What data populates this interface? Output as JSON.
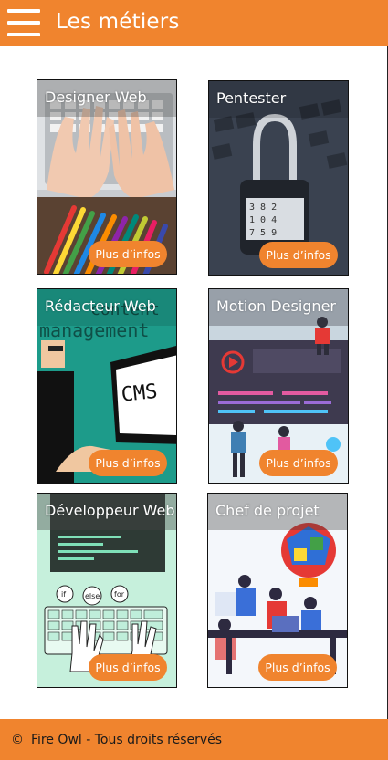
{
  "header": {
    "title": "Les métiers",
    "menu_icon": "hamburger-menu-icon"
  },
  "cards": [
    {
      "title": "Designer Web",
      "button": "Plus d’infos"
    },
    {
      "title": "Pentester",
      "button": "Plus d’infos"
    },
    {
      "title": "Rédacteur Web",
      "button": "Plus d’infos",
      "image_text_1": "content",
      "image_text_2": "management",
      "image_text_3": "CMS"
    },
    {
      "title": "Motion Designer",
      "button": "Plus d’infos"
    },
    {
      "title": "Développeur Web",
      "button": "Plus d’infos",
      "image_text_1": "if",
      "image_text_2": "else",
      "image_text_3": "for"
    },
    {
      "title": "Chef de projet",
      "button": "Plus d’infos"
    }
  ],
  "footer": {
    "copyright_symbol": "©",
    "text": "Fire Owl - Tous droits réservés"
  },
  "colors": {
    "accent": "#f0842e"
  }
}
